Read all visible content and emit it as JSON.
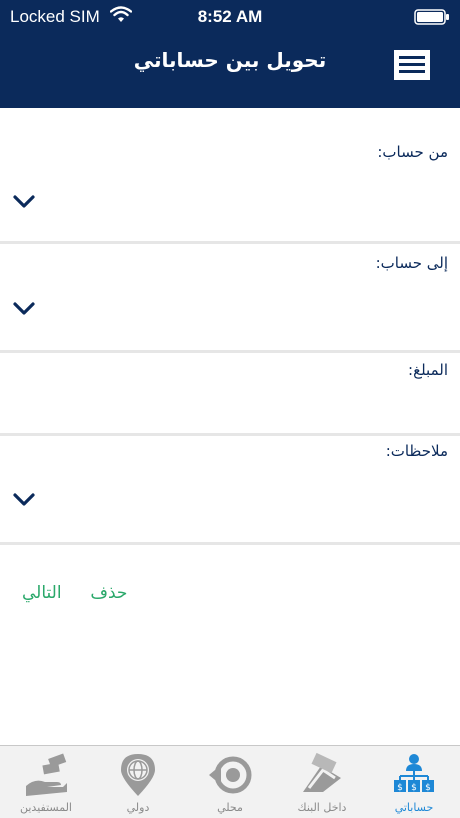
{
  "status_bar": {
    "carrier": "Locked SIM",
    "time": "8:52 AM"
  },
  "header": {
    "title": "تحويل بين حساباتي"
  },
  "form": {
    "from_account_label": "من حساب:",
    "to_account_label": "إلى حساب:",
    "amount_label": "المبلغ:",
    "notes_label": "ملاحظات:"
  },
  "actions": {
    "delete_label": "حذف",
    "next_label": "التالي"
  },
  "tabs": [
    {
      "label": "حساباتي",
      "icon": "accounts-icon",
      "active": true
    },
    {
      "label": "داخل البنك",
      "icon": "within-bank-icon",
      "active": false
    },
    {
      "label": "محلي",
      "icon": "local-icon",
      "active": false
    },
    {
      "label": "دولي",
      "icon": "international-icon",
      "active": false
    },
    {
      "label": "المستفيدين",
      "icon": "beneficiaries-icon",
      "active": false
    }
  ],
  "colors": {
    "header_bg": "#0b2a5b",
    "action_green": "#2aa86a",
    "active_tab": "#1e88d6",
    "inactive_tab": "#8a8a8a"
  }
}
